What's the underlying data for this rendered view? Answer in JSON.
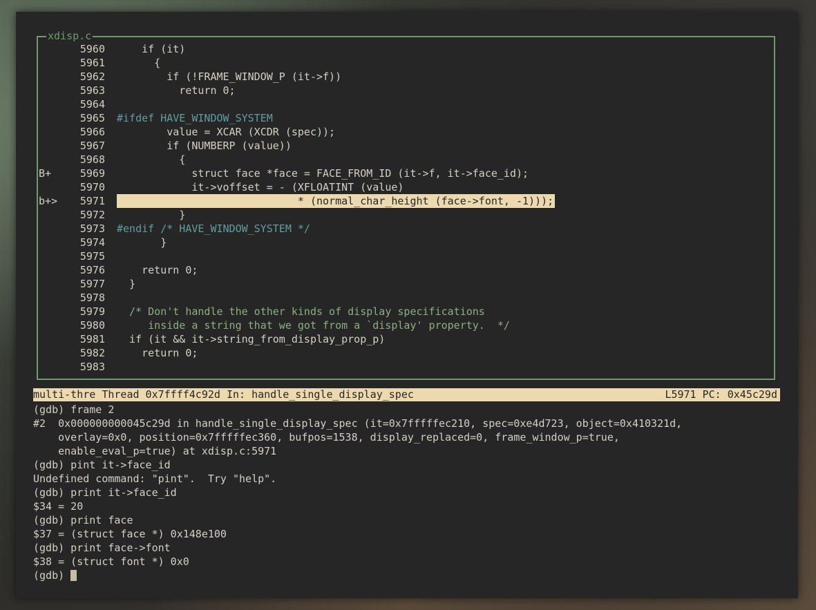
{
  "colors": {
    "frame_border": "#6f9a6b",
    "highlight_bg": "#ecd9ad",
    "keyword": "#5f9ea0",
    "paren": "#c8322f",
    "number": "#c0704a",
    "comment": "#8cb07e",
    "preproc": "#5f9ea0",
    "type": "#c8a23c"
  },
  "source_window": {
    "title": "xdisp.c",
    "lines": [
      {
        "marker": "",
        "num": "5960",
        "code": "    if (it)"
      },
      {
        "marker": "",
        "num": "5961",
        "code": "      {"
      },
      {
        "marker": "",
        "num": "5962",
        "code": "        if (!FRAME_WINDOW_P (it->f))"
      },
      {
        "marker": "",
        "num": "5963",
        "code": "          return 0;"
      },
      {
        "marker": "",
        "num": "5964",
        "code": ""
      },
      {
        "marker": "",
        "num": "5965",
        "code": "#ifdef HAVE_WINDOW_SYSTEM"
      },
      {
        "marker": "",
        "num": "5966",
        "code": "        value = XCAR (XCDR (spec));"
      },
      {
        "marker": "",
        "num": "5967",
        "code": "        if (NUMBERP (value))"
      },
      {
        "marker": "",
        "num": "5968",
        "code": "          {"
      },
      {
        "marker": "B+",
        "num": "5969",
        "code": "            struct face *face = FACE_FROM_ID (it->f, it->face_id);"
      },
      {
        "marker": "",
        "num": "5970",
        "code": "            it->voffset = - (XFLOATINT (value)"
      },
      {
        "marker": "b+>",
        "num": "5971",
        "code": "                             * (normal_char_height (face->font, -1)));"
      },
      {
        "marker": "",
        "num": "5972",
        "code": "          }"
      },
      {
        "marker": "",
        "num": "5973",
        "code": "#endif /* HAVE_WINDOW_SYSTEM */"
      },
      {
        "marker": "",
        "num": "5974",
        "code": "       }"
      },
      {
        "marker": "",
        "num": "5975",
        "code": ""
      },
      {
        "marker": "",
        "num": "5976",
        "code": "    return 0;"
      },
      {
        "marker": "",
        "num": "5977",
        "code": "  }"
      },
      {
        "marker": "",
        "num": "5978",
        "code": ""
      },
      {
        "marker": "",
        "num": "5979",
        "code": "  /* Don't handle the other kinds of display specifications"
      },
      {
        "marker": "",
        "num": "5980",
        "code": "     inside a string that we got from a `display' property.  */"
      },
      {
        "marker": "",
        "num": "5981",
        "code": "  if (it && it->string_from_display_prop_p)"
      },
      {
        "marker": "",
        "num": "5982",
        "code": "    return 0;"
      },
      {
        "marker": "",
        "num": "5983",
        "code": ""
      }
    ]
  },
  "status_bar": {
    "left": "multi-thre Thread 0x7ffff4c92d In: handle_single_display_spec",
    "right": "L5971 PC: 0x45c29d"
  },
  "console": {
    "lines": [
      "(gdb) frame 2",
      "#2  0x000000000045c29d in handle_single_display_spec (it=0x7fffffec210, spec=0xe4d723, object=0x410321d,",
      "    overlay=0x0, position=0x7fffffec360, bufpos=1538, display_replaced=0, frame_window_p=true,",
      "    enable_eval_p=true) at xdisp.c:5971",
      "(gdb) pint it->face_id",
      "Undefined command: \"pint\".  Try \"help\".",
      "(gdb) print it->face_id",
      "$34 = 20",
      "(gdb) print face",
      "$37 = (struct face *) 0x148e100",
      "(gdb) print face->font",
      "$38 = (struct font *) 0x0"
    ],
    "prompt": "(gdb) "
  }
}
